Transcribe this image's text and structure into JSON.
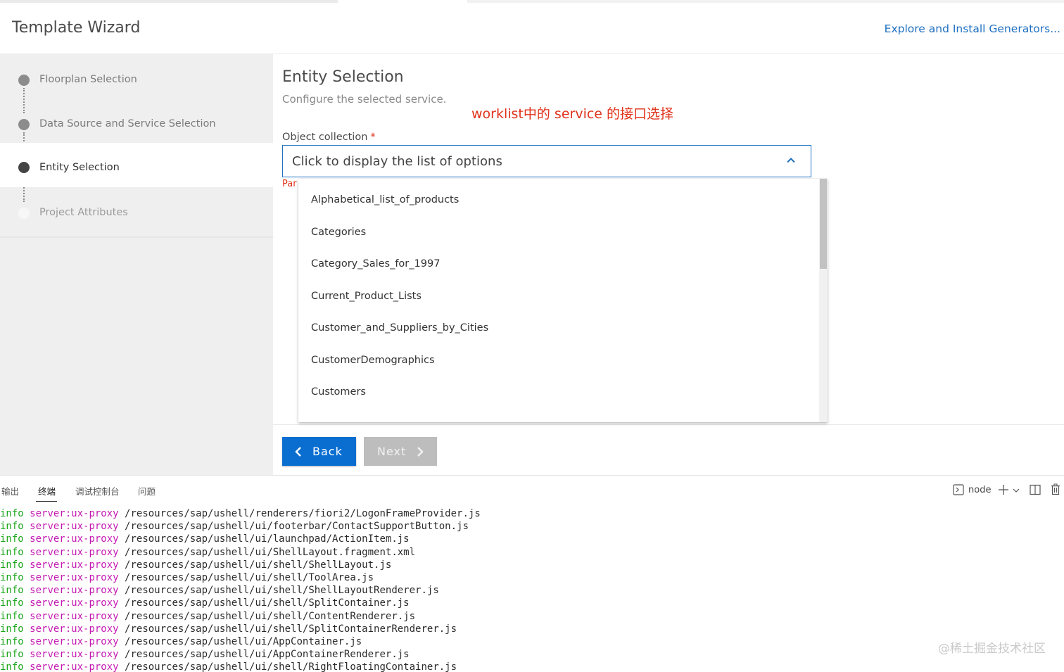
{
  "header": {
    "title": "Template Wizard",
    "explore_link": "Explore and Install Generators..."
  },
  "steps": [
    {
      "label": "Floorplan Selection",
      "state": "completed"
    },
    {
      "label": "Data Source and Service Selection",
      "state": "completed"
    },
    {
      "label": "Entity Selection",
      "state": "active"
    },
    {
      "label": "Project Attributes",
      "state": "pending"
    }
  ],
  "main": {
    "heading": "Entity Selection",
    "subtitle": "Configure the selected service.",
    "annotation": "worklist中的 service 的接口选择",
    "field_label": "Object collection",
    "required_mark": "*",
    "select_placeholder": "Click to display the list of options",
    "error_text": "Par"
  },
  "dropdown_options": [
    "Alphabetical_list_of_products",
    "Categories",
    "Category_Sales_for_1997",
    "Current_Product_Lists",
    "Customer_and_Suppliers_by_Cities",
    "CustomerDemographics",
    "Customers"
  ],
  "footer": {
    "back_label": "Back",
    "next_label": "Next"
  },
  "panel": {
    "tabs": [
      "输出",
      "终端",
      "调试控制台",
      "问题"
    ],
    "active_tab": "终端",
    "shell_name": "node"
  },
  "terminal_lines": [
    {
      "level": "info",
      "source": "server:ux-proxy",
      "path": "/resources/sap/ushell/renderers/fiori2/LogonFrameProvider.js"
    },
    {
      "level": "info",
      "source": "server:ux-proxy",
      "path": "/resources/sap/ushell/ui/footerbar/ContactSupportButton.js"
    },
    {
      "level": "info",
      "source": "server:ux-proxy",
      "path": "/resources/sap/ushell/ui/launchpad/ActionItem.js"
    },
    {
      "level": "info",
      "source": "server:ux-proxy",
      "path": "/resources/sap/ushell/ui/ShellLayout.fragment.xml"
    },
    {
      "level": "info",
      "source": "server:ux-proxy",
      "path": "/resources/sap/ushell/ui/shell/ShellLayout.js"
    },
    {
      "level": "info",
      "source": "server:ux-proxy",
      "path": "/resources/sap/ushell/ui/shell/ToolArea.js"
    },
    {
      "level": "info",
      "source": "server:ux-proxy",
      "path": "/resources/sap/ushell/ui/shell/ShellLayoutRenderer.js"
    },
    {
      "level": "info",
      "source": "server:ux-proxy",
      "path": "/resources/sap/ushell/ui/shell/SplitContainer.js"
    },
    {
      "level": "info",
      "source": "server:ux-proxy",
      "path": "/resources/sap/ushell/ui/shell/ContentRenderer.js"
    },
    {
      "level": "info",
      "source": "server:ux-proxy",
      "path": "/resources/sap/ushell/ui/shell/SplitContainerRenderer.js"
    },
    {
      "level": "info",
      "source": "server:ux-proxy",
      "path": "/resources/sap/ushell/ui/AppContainer.js"
    },
    {
      "level": "info",
      "source": "server:ux-proxy",
      "path": "/resources/sap/ushell/ui/AppContainerRenderer.js"
    },
    {
      "level": "info",
      "source": "server:ux-proxy",
      "path": "/resources/sap/ushell/ui/shell/RightFloatingContainer.js"
    }
  ],
  "watermark": "@稀土掘金技术社区",
  "colors": {
    "accent": "#0a6ed1",
    "link": "#1f70c1",
    "annotation": "#e0321b",
    "log_level": "#1aa61a",
    "log_source": "#c418b2"
  }
}
